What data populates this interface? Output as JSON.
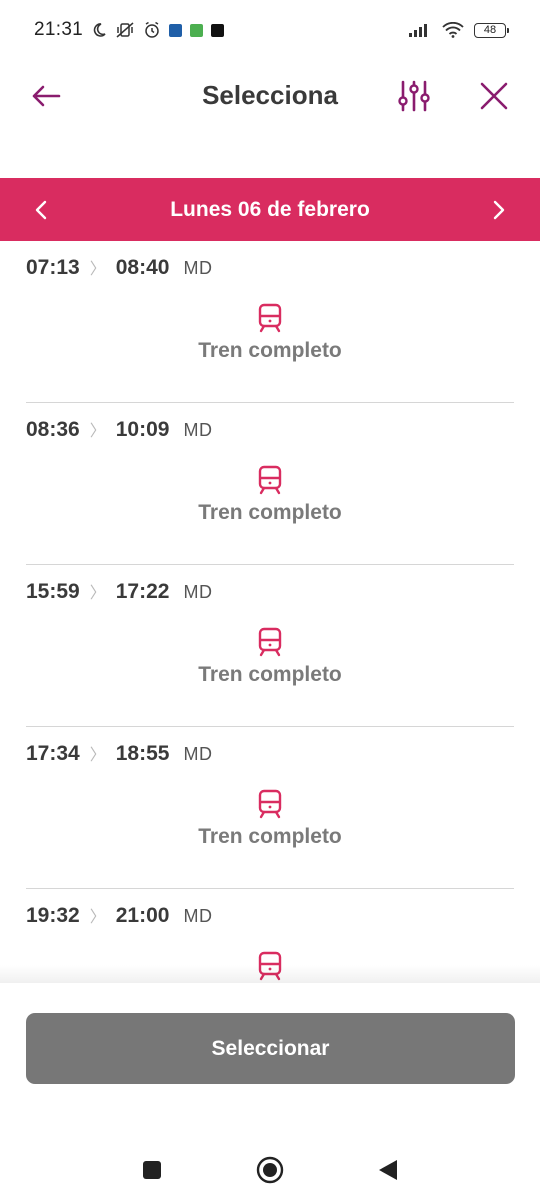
{
  "status_bar": {
    "time": "21:31",
    "battery": "48"
  },
  "header": {
    "title": "Selecciona"
  },
  "date_bar": {
    "label": "Lunes 06 de febrero"
  },
  "trains": [
    {
      "departure": "07:13",
      "arrival": "08:40",
      "type": "MD",
      "status": "Tren completo"
    },
    {
      "departure": "08:36",
      "arrival": "10:09",
      "type": "MD",
      "status": "Tren completo"
    },
    {
      "departure": "15:59",
      "arrival": "17:22",
      "type": "MD",
      "status": "Tren completo"
    },
    {
      "departure": "17:34",
      "arrival": "18:55",
      "type": "MD",
      "status": "Tren completo"
    },
    {
      "departure": "19:32",
      "arrival": "21:00",
      "type": "MD",
      "status": ""
    }
  ],
  "select_button": {
    "label": "Seleccionar"
  },
  "colors": {
    "accent": "#d92c60",
    "header_icon": "#8a1c6e",
    "button_disabled": "#777777"
  },
  "icons": {
    "back": "arrow-left-icon",
    "filter": "sliders-icon",
    "close": "close-icon",
    "prev_date": "chevron-left-icon",
    "next_date": "chevron-right-icon",
    "train": "train-icon"
  }
}
